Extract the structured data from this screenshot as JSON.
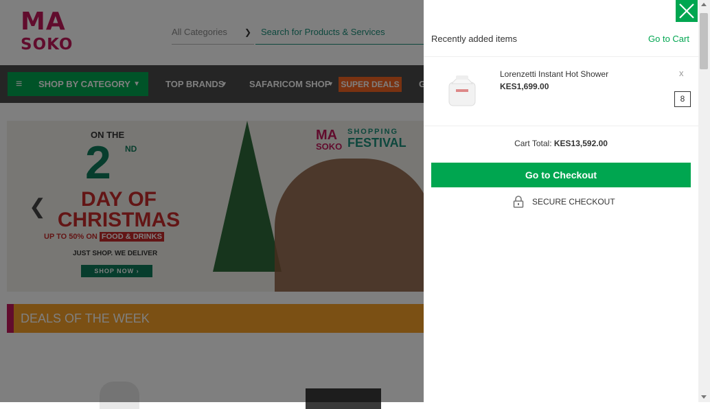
{
  "header": {
    "logo_top": "MA",
    "logo_bottom": "SOKO",
    "category_select": "All Categories",
    "search_placeholder": "Search for Products & Services"
  },
  "nav": {
    "shop_by_category": "SHOP BY CATEGORY",
    "top_brands": "TOP BRANDS",
    "safaricom_shop": "SAFARICOM SHOP",
    "super_deals": "SUPER DEALS",
    "partial": "G"
  },
  "banner": {
    "on_the": "ON THE",
    "day_num": "2",
    "day_suffix": "ND",
    "day_of_christmas": "DAY OF CHRISTMAS",
    "upto": "UP TO 50% ON",
    "food_drinks": "FOOD & DRINKS",
    "just_shop": "JUST SHOP. WE DELIVER",
    "shop_now": "SHOP NOW ›",
    "festival_logo_top": "MA",
    "festival_logo_bottom": "SOKO",
    "festival_shopping": "SHOPPING",
    "festival_title": "FESTIVAL"
  },
  "deals_section": {
    "title": "DEALS OF THE WEEK"
  },
  "cart": {
    "recently_added": "Recently added items",
    "go_to_cart": "Go to Cart",
    "item": {
      "name": "Lorenzetti Instant Hot Shower",
      "price": "KES1,699.00",
      "quantity": "8",
      "remove": "x"
    },
    "total_label": "Cart Total:",
    "total_value": "KES13,592.00",
    "checkout_button": "Go to Checkout",
    "secure_checkout": "SECURE CHECKOUT"
  },
  "colors": {
    "accent_green": "#00a650",
    "brand_pink": "#c2185b",
    "deals_orange": "#f7a128",
    "super_deals_orange": "#f26522",
    "nav_dark": "#4a4a4a"
  },
  "icons": [
    "menu-icon",
    "chevron-down-icon",
    "carousel-prev-icon",
    "close-icon",
    "lock-icon",
    "scroll-up-icon",
    "scroll-down-icon"
  ]
}
